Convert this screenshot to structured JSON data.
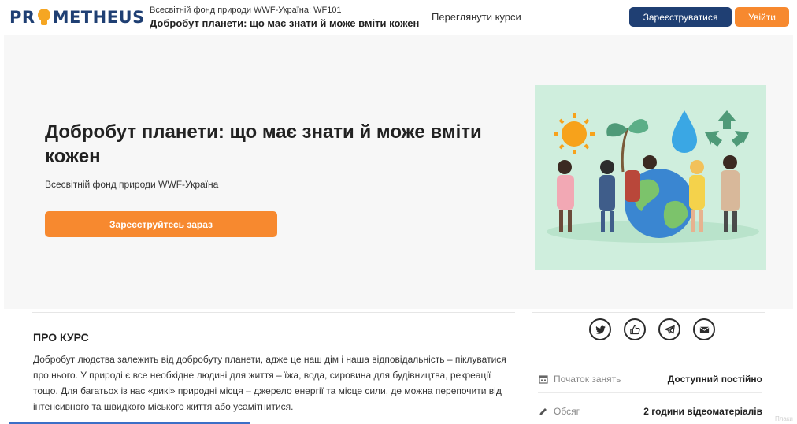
{
  "header": {
    "logo_parts": [
      "PR",
      "METHEUS"
    ],
    "course_org_code": "Всесвітній фонд природи WWF-Україна: WF101",
    "course_title": "Добробут планети: що має знати й може вміти кожен",
    "browse_link": "Переглянути курси",
    "register_label": "Зареєструватися",
    "login_label": "Увійти"
  },
  "hero": {
    "title": "Добробут планети: що має знати й може вміти кожен",
    "org": "Всесвітній фонд природи WWF-Україна",
    "enroll_label": "Зареєструйтесь зараз"
  },
  "about": {
    "heading": "ПРО КУРС",
    "text": "Добробут людства залежить від добробуту планети, адже це наш дім і наша відповідальність – піклуватися про нього. У природі є все необхідне людині для життя – їжа, вода, сировина для будівництва, рекреації тощо. Для багатьох із нас «дикі» природні місця – джерело енергії та місце сили, де можна перепочити від інтенсивного та швидкого міського життя або усамітнитися."
  },
  "share": [
    "twitter-icon",
    "like-icon",
    "telegram-icon",
    "email-icon"
  ],
  "info": [
    {
      "icon": "calendar-icon",
      "label": "Початок занять",
      "value": "Доступний постійно"
    },
    {
      "icon": "pencil-icon",
      "label": "Обсяг",
      "value": "2 години відеоматеріалів"
    }
  ],
  "corner_text": "Плаки",
  "colors": {
    "navy": "#1f3f73",
    "orange": "#f7892f",
    "hero_bg": "#f7f7f7",
    "image_bg": "#cfeedd"
  }
}
